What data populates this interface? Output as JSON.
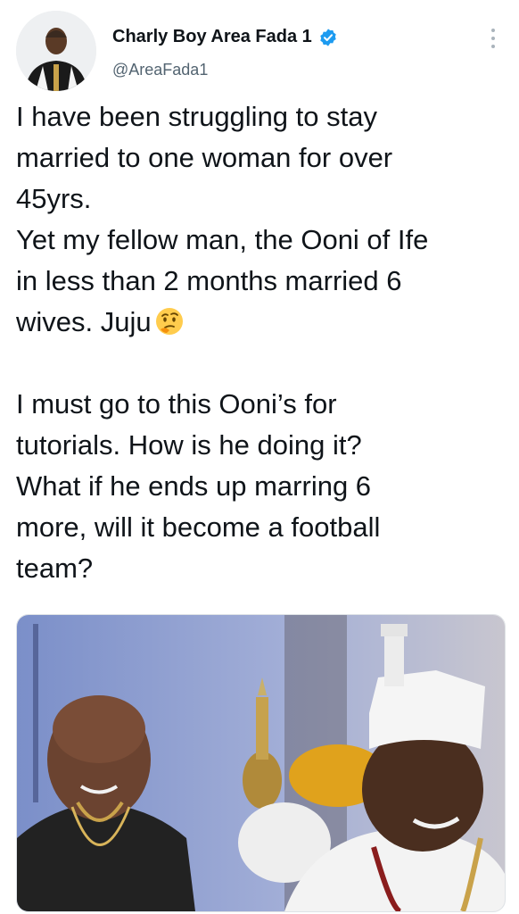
{
  "tweet": {
    "display_name": "Charly Boy Area Fada 1",
    "handle": "@AreaFada1",
    "lines": [
      "I have been struggling to stay\nmarried to one woman for over\n45yrs.\nYet my fellow man, the Ooni of Ife\nin less than 2 months married 6\nwives. Juju",
      "I must go to this Ooni’s for\ntutorials. How is he doing it?\nWhat if he ends up marring 6\nmore, will it become a football\nteam?"
    ],
    "emoji": "thinking-face-emoji",
    "verified_color": "#1d9bf0"
  },
  "icons": {
    "verified": "verified-badge-icon",
    "more": "more-vertical-icon"
  }
}
